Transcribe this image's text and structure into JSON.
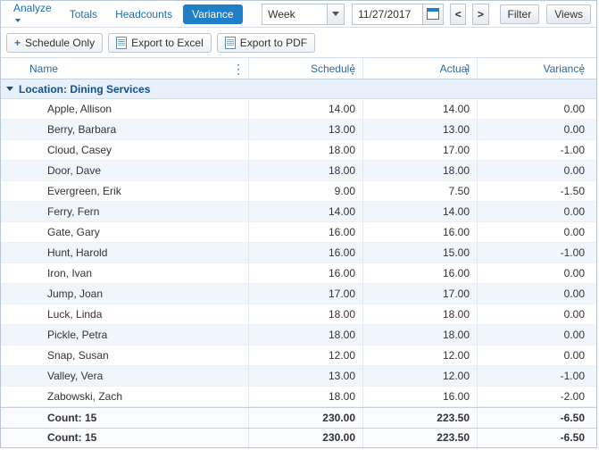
{
  "toolbar1": {
    "analyze_label": "Analyze",
    "totals_label": "Totals",
    "headcounts_label": "Headcounts",
    "variance_label": "Variance",
    "period_select": "Week",
    "date_value": "11/27/2017",
    "prev_label": "<",
    "next_label": ">",
    "filter_label": "Filter",
    "views_label": "Views"
  },
  "toolbar2": {
    "schedule_only_label": "Schedule Only",
    "export_excel_label": "Export to Excel",
    "export_pdf_label": "Export to PDF"
  },
  "columns": {
    "name": "Name",
    "schedule": "Schedule",
    "actual": "Actual",
    "variance": "Variance"
  },
  "group": {
    "label": "Location: Dining Services"
  },
  "rows": [
    {
      "name": "Apple, Allison",
      "schedule": "14.00",
      "actual": "14.00",
      "variance": "0.00"
    },
    {
      "name": "Berry, Barbara",
      "schedule": "13.00",
      "actual": "13.00",
      "variance": "0.00"
    },
    {
      "name": "Cloud, Casey",
      "schedule": "18.00",
      "actual": "17.00",
      "variance": "-1.00"
    },
    {
      "name": "Door, Dave",
      "schedule": "18.00",
      "actual": "18.00",
      "variance": "0.00"
    },
    {
      "name": "Evergreen, Erik",
      "schedule": "9.00",
      "actual": "7.50",
      "variance": "-1.50"
    },
    {
      "name": "Ferry, Fern",
      "schedule": "14.00",
      "actual": "14.00",
      "variance": "0.00"
    },
    {
      "name": "Gate, Gary",
      "schedule": "16.00",
      "actual": "16.00",
      "variance": "0.00"
    },
    {
      "name": "Hunt, Harold",
      "schedule": "16.00",
      "actual": "15.00",
      "variance": "-1.00"
    },
    {
      "name": "Iron, Ivan",
      "schedule": "16.00",
      "actual": "16.00",
      "variance": "0.00"
    },
    {
      "name": "Jump, Joan",
      "schedule": "17.00",
      "actual": "17.00",
      "variance": "0.00"
    },
    {
      "name": "Luck, Linda",
      "schedule": "18.00",
      "actual": "18.00",
      "variance": "0.00"
    },
    {
      "name": "Pickle, Petra",
      "schedule": "18.00",
      "actual": "18.00",
      "variance": "0.00"
    },
    {
      "name": "Snap, Susan",
      "schedule": "12.00",
      "actual": "12.00",
      "variance": "0.00"
    },
    {
      "name": "Valley, Vera",
      "schedule": "13.00",
      "actual": "12.00",
      "variance": "-1.00"
    },
    {
      "name": "Zabowski, Zach",
      "schedule": "18.00",
      "actual": "16.00",
      "variance": "-2.00"
    }
  ],
  "totals": {
    "count_label": "Count: 15",
    "schedule": "230.00",
    "actual": "223.50",
    "variance": "-6.50"
  }
}
